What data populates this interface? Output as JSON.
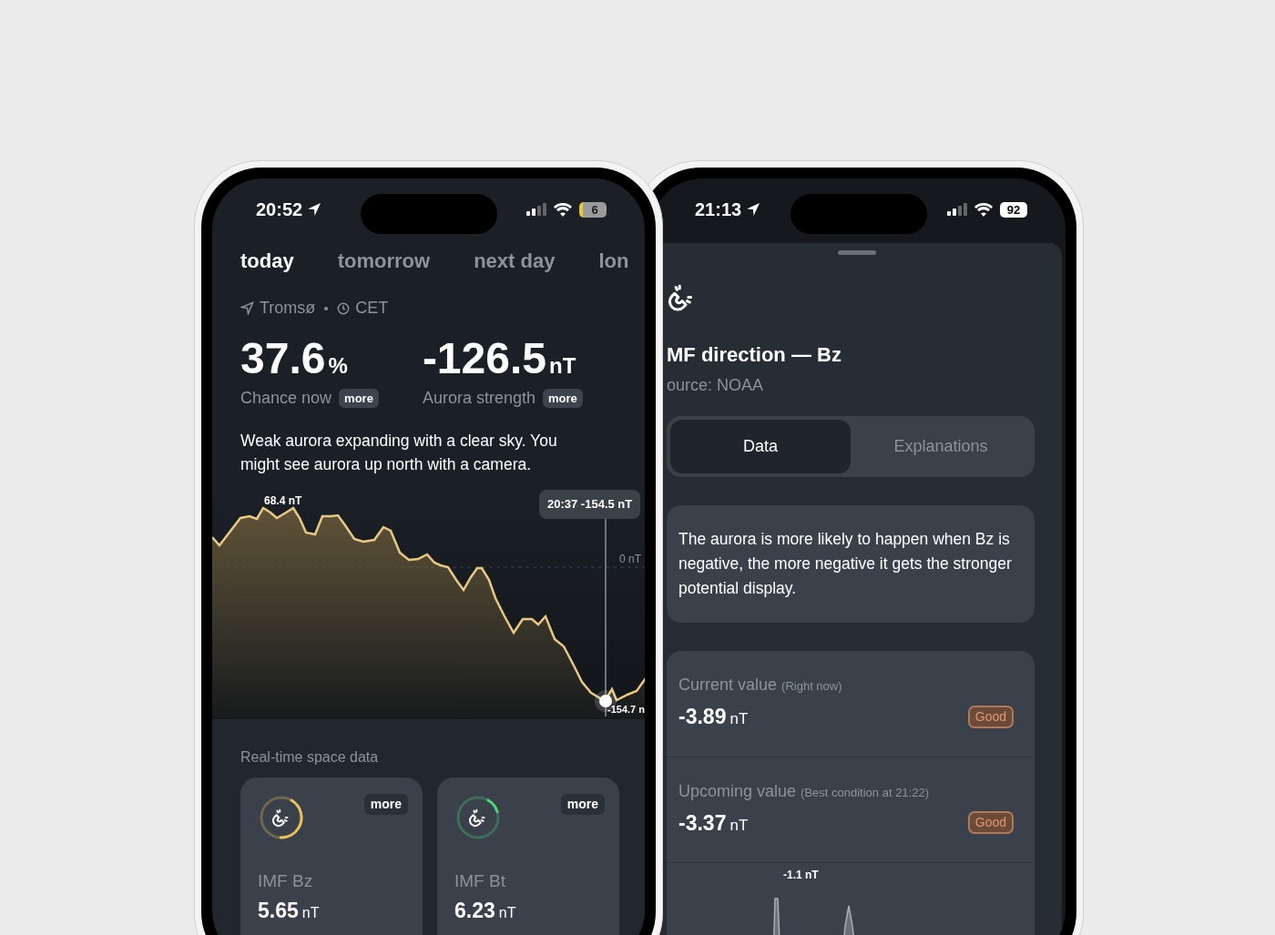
{
  "left_phone": {
    "status_bar": {
      "time": "20:52",
      "battery": "6"
    },
    "tabs": [
      {
        "label": "today",
        "selected": true
      },
      {
        "label": "tomorrow",
        "selected": false
      },
      {
        "label": "next day",
        "selected": false
      },
      {
        "label": "lon",
        "selected": false
      }
    ],
    "location": "Tromsø",
    "timezone": "CET",
    "stats": [
      {
        "value": "37.6",
        "unit": "%",
        "label": "Chance now",
        "more": "more"
      },
      {
        "value": "-126.5",
        "unit": "nT",
        "label": "Aurora strength",
        "more": "more"
      }
    ],
    "description": "Weak aurora expanding with a clear sky. You might see aurora up north with a camera.",
    "chart": {
      "peak_label": "68.4 nT",
      "zero_label": "0 nT",
      "low_label": "-154.7 n",
      "tooltip": "20:37 -154.5 nT"
    },
    "section_title": "Real-time space data",
    "cards": [
      {
        "name": "IMF Bz",
        "value": "5.65",
        "unit": "nT",
        "more": "more",
        "level": 0.42,
        "color": "#e8c15a"
      },
      {
        "name": "IMF Bt",
        "value": "6.23",
        "unit": "nT",
        "more": "more",
        "level": 0.12,
        "color": "#4fd17e"
      }
    ]
  },
  "right_phone": {
    "status_bar": {
      "time": "21:13",
      "battery": "92"
    },
    "title": "MF direction — Bz",
    "source": "ource: NOAA",
    "segments": [
      {
        "label": "Data",
        "selected": true
      },
      {
        "label": "Explanations",
        "selected": false
      }
    ],
    "explanation": "The aurora is more likely to happen when Bz is negative, the more negative it gets the stronger potential display.",
    "readings": [
      {
        "label": "Current value",
        "note": "(Right now)",
        "value": "-3.89",
        "unit": "nT",
        "badge": "Good"
      },
      {
        "label": "Upcoming value",
        "note": "(Best condition at 21:22)",
        "value": "-3.37",
        "unit": "nT",
        "badge": "Good"
      }
    ],
    "chart": {
      "peak_label": "-1.1 nT"
    }
  }
}
